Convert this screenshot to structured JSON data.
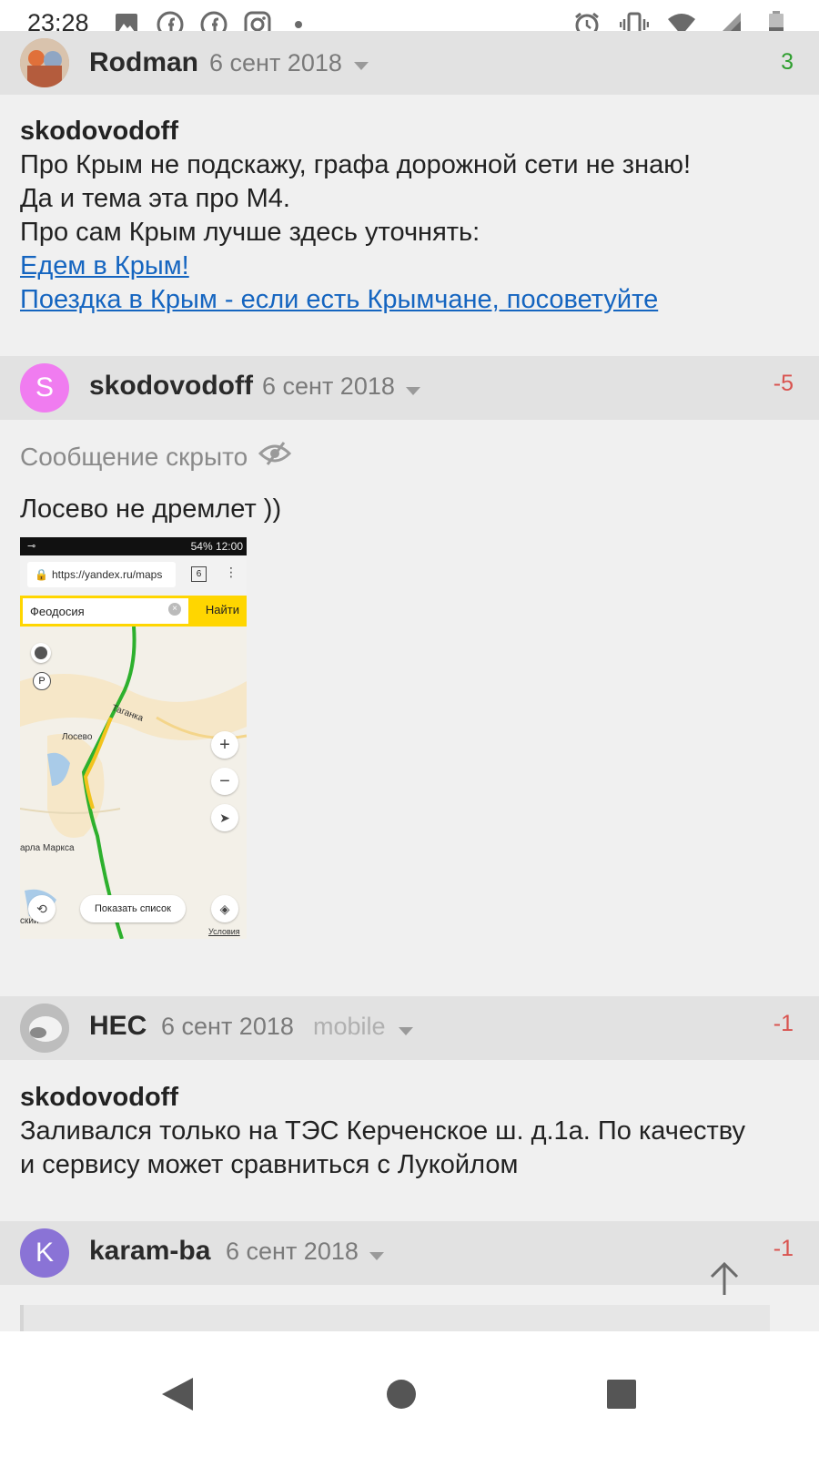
{
  "status_bar": {
    "time": "23:28",
    "icons": [
      "image-icon",
      "facebook-icon",
      "facebook-icon",
      "instagram-icon",
      "dot-icon",
      "alarm-icon",
      "vibrate-icon",
      "wifi-icon",
      "signal-icon",
      "battery-icon"
    ]
  },
  "posts": [
    {
      "author": "Rodman",
      "date": "6 сент 2018",
      "score": "3",
      "score_color": "#2e9e2e",
      "quote_author": "skodovodoff",
      "lines": [
        "Про Крым не подскажу, графа дорожной сети не знаю!",
        "Да и тема эта про М4.",
        "Про сам Крым лучше здесь уточнять:"
      ],
      "links": [
        "Едем в Крым!",
        "Поездка в Крым - если есть Крымчане, посоветуйте"
      ]
    },
    {
      "author": "skodovodoff",
      "avatar_letter": "S",
      "avatar_color": "#f07cf0",
      "date": "6 сент 2018",
      "score": "-5",
      "score_color": "#d9534f",
      "hidden_label": "Сообщение скрыто",
      "text": "Лосево не дремлет ))",
      "screenshot": {
        "status_text": "54% 12:00",
        "url": "https://yandex.ru/maps",
        "tabs_count": "6",
        "search_value": "Феодосия",
        "search_button": "Найти",
        "map_labels": [
          "Таганка",
          "Лосево",
          "арла Маркса",
          "ский"
        ],
        "list_button": "Показать список",
        "terms_link": "Условия"
      }
    },
    {
      "author": "HEC",
      "date": "6 сент 2018",
      "client": "mobile",
      "score": "-1",
      "score_color": "#d9534f",
      "quote_author": "skodovodoff",
      "lines": [
        "Заливался только на ТЭС Керченское ш. д.1а. По качеству",
        "и сервису может сравниться с Лукойлом"
      ]
    },
    {
      "author": "karam-ba",
      "avatar_letter": "K",
      "avatar_color": "#8a73d6",
      "date": "6 сент 2018",
      "score": "-1",
      "score_color": "#d9534f"
    }
  ],
  "nav": [
    "back-icon",
    "home-icon",
    "recents-icon"
  ]
}
